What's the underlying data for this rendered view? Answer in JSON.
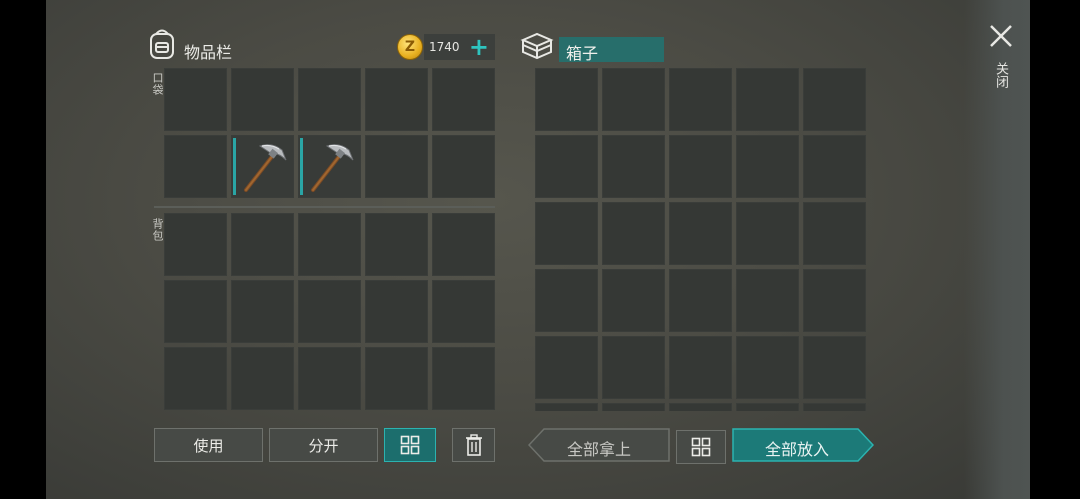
{
  "inventory": {
    "title": "物品栏",
    "icon": "backpack-icon",
    "coins": "1740",
    "coin_icon": "z-coin-icon",
    "add_icon": "plus-icon",
    "pocket_label": "口袋",
    "backpack_label": "背包",
    "pocket_slots": [
      {
        "item": ""
      },
      {
        "item": ""
      },
      {
        "item": ""
      },
      {
        "item": ""
      },
      {
        "item": ""
      },
      {
        "item": ""
      },
      {
        "item": "pickaxe-icon"
      },
      {
        "item": "pickaxe-icon"
      },
      {
        "item": ""
      },
      {
        "item": ""
      }
    ],
    "backpack_slot_count": 15
  },
  "chest": {
    "title": "箱子",
    "icon": "chest-icon",
    "slot_count": 35
  },
  "close": {
    "icon": "close-icon",
    "label": "关闭"
  },
  "buttons": {
    "use": "使用",
    "split": "分开",
    "sort_icon": "grid-sort-icon",
    "trash_icon": "trash-icon",
    "take_all": "全部拿上",
    "put_all": "全部放入"
  },
  "colors": {
    "accent": "#2aa5a5",
    "accent_button": "#1c6e6d",
    "slot": "#353835",
    "background": "#4b4b44"
  }
}
